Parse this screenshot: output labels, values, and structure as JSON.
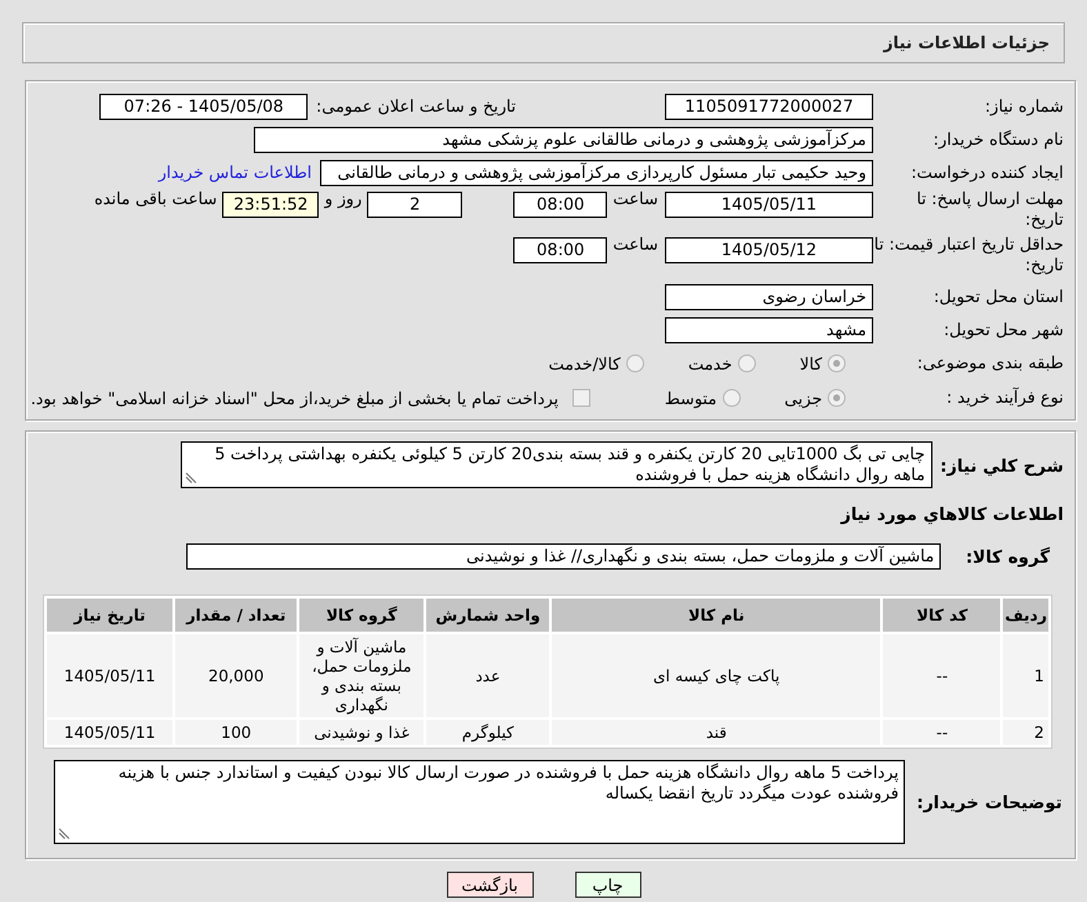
{
  "header": {
    "title": "جزئیات اطلاعات نیاز"
  },
  "details": {
    "need_number": {
      "label": "شماره نیاز:",
      "value": "1105091772000027"
    },
    "announce": {
      "label": "تاریخ و ساعت اعلان عمومی:",
      "value": "1405/05/08 - 07:26"
    },
    "buyer_org": {
      "label": "نام دستگاه خریدار:",
      "value": "مرکزآموزشی  پژوهشی و درمانی طالقانی   علوم پزشکی مشهد"
    },
    "requester": {
      "label": "ایجاد کننده درخواست:",
      "value": "وحید حکیمی تبار مسئول کارپردازی مرکزآموزشی  پژوهشی و درمانی طالقانی",
      "link": "اطلاعات تماس خریدار"
    },
    "deadline": {
      "label": "مهلت ارسال پاسخ: تا تاریخ:",
      "date": "1405/05/11",
      "time_label": "ساعت",
      "time": "08:00",
      "days": "2",
      "days_label": "روز و",
      "remaining": "23:51:52",
      "remaining_label": "ساعت باقی مانده"
    },
    "validity": {
      "label": "حداقل تاریخ اعتبار قیمت: تا تاریخ:",
      "date": "1405/05/12",
      "time_label": "ساعت",
      "time": "08:00"
    },
    "province": {
      "label": "استان محل تحویل:",
      "value": "خراسان رضوی"
    },
    "city": {
      "label": "شهر محل تحویل:",
      "value": "مشهد"
    },
    "category": {
      "label": "طبقه بندی موضوعی:",
      "options": [
        {
          "label": "کالا",
          "selected": true
        },
        {
          "label": "خدمت",
          "selected": false
        },
        {
          "label": "کالا/خدمت",
          "selected": false
        }
      ]
    },
    "process": {
      "label": "نوع فرآیند خرید :",
      "options": [
        {
          "label": "جزیی",
          "selected": true
        },
        {
          "label": "متوسط",
          "selected": false
        }
      ],
      "payment": {
        "label": "پرداخت تمام یا بخشی از مبلغ خرید،از محل \"اسناد خزانه اسلامی\" خواهد بود.",
        "checked": false
      }
    }
  },
  "goods": {
    "description": {
      "label": "شرح کلي نیاز:",
      "value": "چایی تی بگ 1000تایی 20 کارتن یکنفره و قند بسته بندی20 کارتن 5 کیلوئی  یکنفره بهداشتی  پرداخت 5 ماهه روال دانشگاه  هزینه حمل با فروشنده"
    },
    "title": "اطلاعات کالاهاي مورد نیاز",
    "group": {
      "label": "گروه کالا:",
      "value": "ماشین آلات و ملزومات حمل، بسته بندی و نگهداری// غذا و نوشیدنی"
    },
    "table": {
      "columns": [
        "ردیف",
        "کد کالا",
        "نام کالا",
        "واحد شمارش",
        "گروه کالا",
        "تعداد / مقدار",
        "تاریخ نیاز"
      ],
      "rows": [
        [
          "1",
          "--",
          "پاکت چای کیسه ای",
          "عدد",
          "ماشین آلات و ملزومات حمل، بسته بندی و نگهداری",
          "20,000",
          "1405/05/11"
        ],
        [
          "2",
          "--",
          "قند",
          "کیلوگرم",
          "غذا و نوشیدنی",
          "100",
          "1405/05/11"
        ]
      ]
    },
    "notes": {
      "label": "توضیحات خریدار:",
      "value": "پرداخت 5 ماهه روال دانشگاه هزینه حمل با فروشنده در صورت ارسال کالا نبودن کیفیت و استاندارد جنس با هزینه فروشنده عودت میگردد تاریخ انقضا یکساله"
    }
  },
  "buttons": [
    {
      "label": "چاپ",
      "kind": "print"
    },
    {
      "label": "بازگشت",
      "kind": "back"
    }
  ]
}
